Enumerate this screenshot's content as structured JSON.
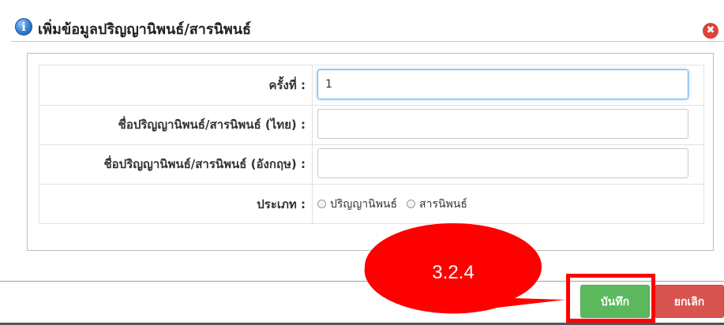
{
  "dialog": {
    "title": "เพิ่มข้อมูลปริญญานิพนธ์/สารนิพนธ์",
    "info_icon": "info-icon",
    "close_icon": "close-icon",
    "close_glyph": "✖"
  },
  "form": {
    "round": {
      "label": "ครั้งที่ :",
      "value": "1"
    },
    "title_th": {
      "label": "ชื่อปริญญานิพนธ์/สารนิพนธ์ (ไทย) :",
      "value": ""
    },
    "title_en": {
      "label": "ชื่อปริญญานิพนธ์/สารนิพนธ์ (อังกฤษ) :",
      "value": ""
    },
    "type": {
      "label": "ประเภท :",
      "options": [
        "ปริญญานิพนธ์",
        "สารนิพนธ์"
      ]
    }
  },
  "footer": {
    "save_label": "บันทึก",
    "cancel_label": "ยกเลิก"
  },
  "annotation": {
    "callout_text": "3.2.4",
    "color": "#ff0000"
  },
  "colors": {
    "save": "#5cb85c",
    "cancel": "#d9534f",
    "focus": "#66afe9"
  }
}
